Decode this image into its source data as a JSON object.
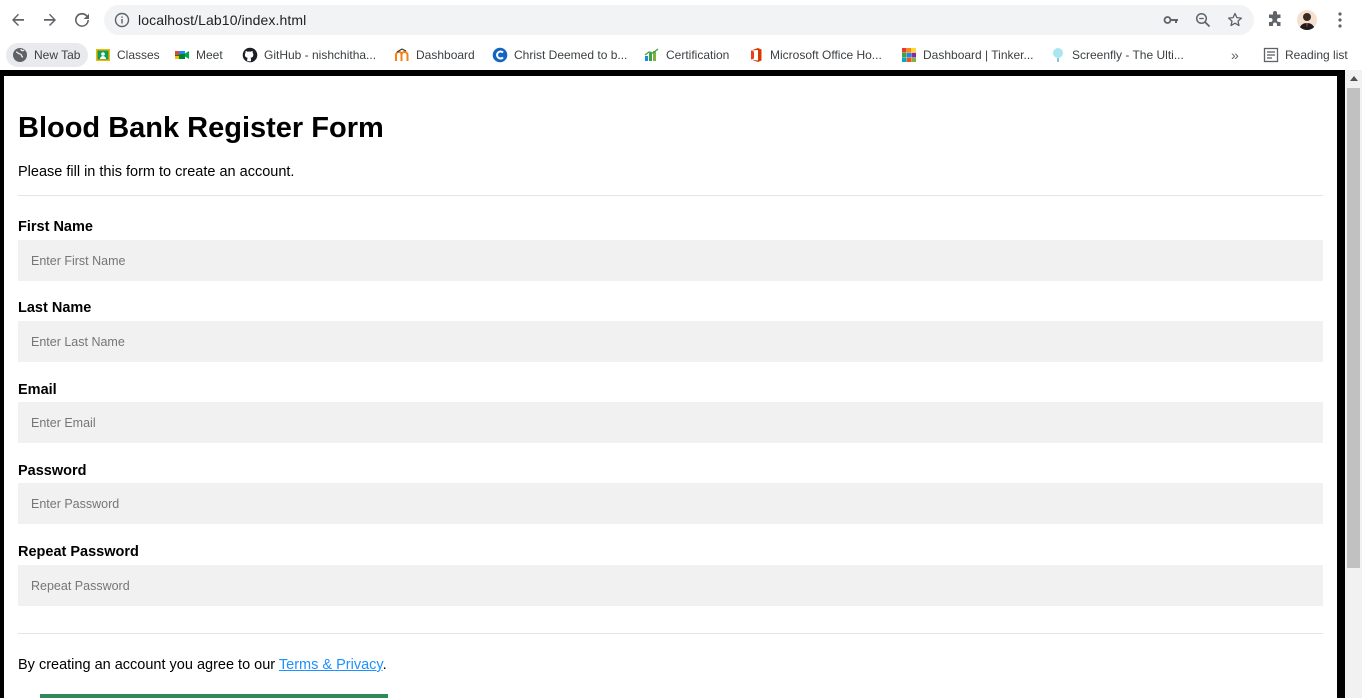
{
  "browser": {
    "url": "localhost/Lab10/index.html",
    "icons": {
      "back": "arrow-left-icon",
      "forward": "arrow-right-icon",
      "reload": "reload-icon",
      "info": "info-icon",
      "key": "key-icon",
      "zoom": "zoom-icon",
      "star": "star-icon",
      "extensions": "puzzle-icon",
      "menu": "kebab-menu-icon"
    },
    "bookmarks": [
      {
        "label": "New Tab"
      },
      {
        "label": "Classes"
      },
      {
        "label": "Meet"
      },
      {
        "label": "GitHub - nishchitha..."
      },
      {
        "label": "Dashboard"
      },
      {
        "label": "Christ Deemed to b..."
      },
      {
        "label": "Certification"
      },
      {
        "label": "Microsoft Office Ho..."
      },
      {
        "label": "Dashboard | Tinker..."
      },
      {
        "label": "Screenfly - The Ulti..."
      }
    ],
    "overflow_label": "»",
    "reading_list_label": "Reading list"
  },
  "form": {
    "title": "Blood Bank Register Form",
    "intro": "Please fill in this form to create an account.",
    "fields": [
      {
        "label": "First Name",
        "placeholder": "Enter First Name"
      },
      {
        "label": "Last Name",
        "placeholder": "Enter Last Name"
      },
      {
        "label": "Email",
        "placeholder": "Enter Email"
      },
      {
        "label": "Password",
        "placeholder": "Enter Password"
      },
      {
        "label": "Repeat Password",
        "placeholder": "Repeat Password"
      }
    ],
    "terms_prefix": "By creating an account you agree to our ",
    "terms_link": "Terms & Privacy",
    "terms_suffix": "."
  },
  "colors": {
    "link": "#1e90ff",
    "input_bg": "#f1f1f1",
    "frame": "#000000"
  }
}
